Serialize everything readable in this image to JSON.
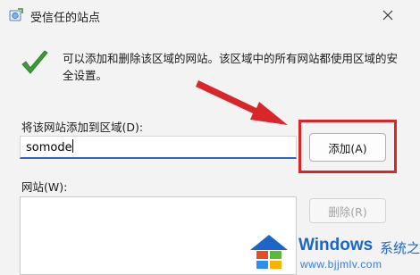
{
  "window": {
    "title": "受信任的站点",
    "close_icon": "close-icon"
  },
  "description": "可以添加和删除该区域的网站。该区域中的所有网站都使用区域的安全设置。",
  "add_field": {
    "label": "将该网站添加到区域(D):",
    "value": "somode"
  },
  "buttons": {
    "add_label": "添加(A)",
    "remove_label": "删除(R)"
  },
  "sites": {
    "label": "网站(W):",
    "items": []
  },
  "annotation": {
    "color": "#d9262b"
  },
  "watermark": {
    "brand": "Windows",
    "brand_cn": "系统之家",
    "url": "www.bjjmlv.com"
  }
}
